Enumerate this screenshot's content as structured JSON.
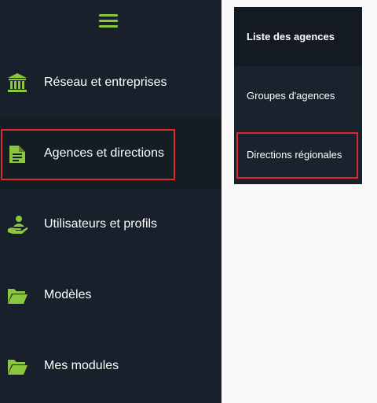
{
  "sidebar": {
    "menu_icon": "hamburger-menu-icon",
    "items": [
      {
        "label": "Réseau et entreprises",
        "icon": "bank-icon"
      },
      {
        "label": "Agences et directions",
        "icon": "document-icon"
      },
      {
        "label": "Utilisateurs et profils",
        "icon": "user-hand-icon"
      },
      {
        "label": "Modèles",
        "icon": "folder-icon"
      },
      {
        "label": "Mes modules",
        "icon": "folder-icon"
      }
    ]
  },
  "submenu": {
    "items": [
      {
        "label": "Liste des agences"
      },
      {
        "label": "Groupes d'agences"
      },
      {
        "label": "Directions régionales"
      }
    ]
  },
  "colors": {
    "sidebar_bg": "#18212b",
    "accent_green": "#8cc63f",
    "highlight_red": "#e0272f",
    "page_bg": "#f9f9f9"
  }
}
